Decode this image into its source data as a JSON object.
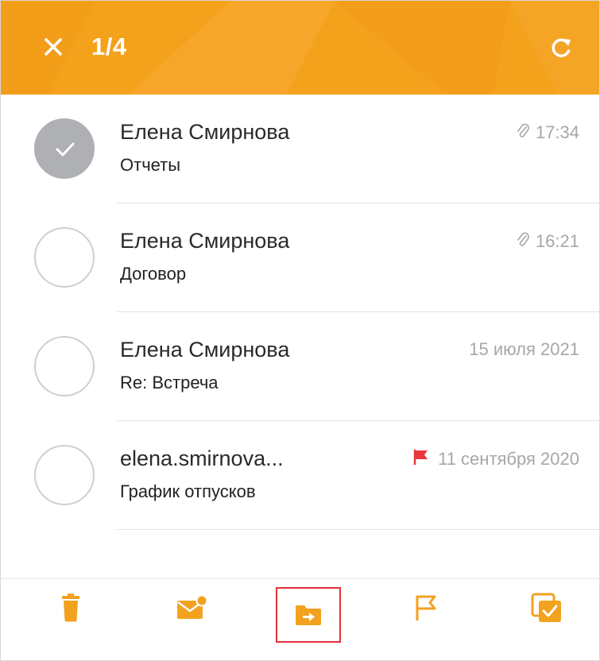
{
  "header": {
    "selection_count": "1/4",
    "close_icon": "close-icon",
    "refresh_icon": "refresh-icon",
    "color": "#f4a11c"
  },
  "messages": [
    {
      "sender": "Елена Смирнова",
      "subject": "Отчеты",
      "time": "17:34",
      "attachment": true,
      "flagged": false,
      "selected": true
    },
    {
      "sender": "Елена Смирнова",
      "subject": "Договор",
      "time": "16:21",
      "attachment": true,
      "flagged": false,
      "selected": false
    },
    {
      "sender": "Елена Смирнова",
      "subject": "Re: Встреча",
      "time": "15 июля 2021",
      "attachment": false,
      "flagged": false,
      "selected": false
    },
    {
      "sender": "elena.smirnova...",
      "subject": "График отпусков",
      "time": "11 сентября 2020",
      "attachment": false,
      "flagged": true,
      "selected": false
    }
  ],
  "toolbar": {
    "items": [
      "trash-icon",
      "mark-unread-icon",
      "move-to-folder-icon",
      "flag-icon",
      "select-all-icon"
    ],
    "highlighted": "move-to-folder-icon",
    "accent": "#f2a21f",
    "highlight_color": "#e0313a",
    "flag_color": "#e8363f"
  }
}
